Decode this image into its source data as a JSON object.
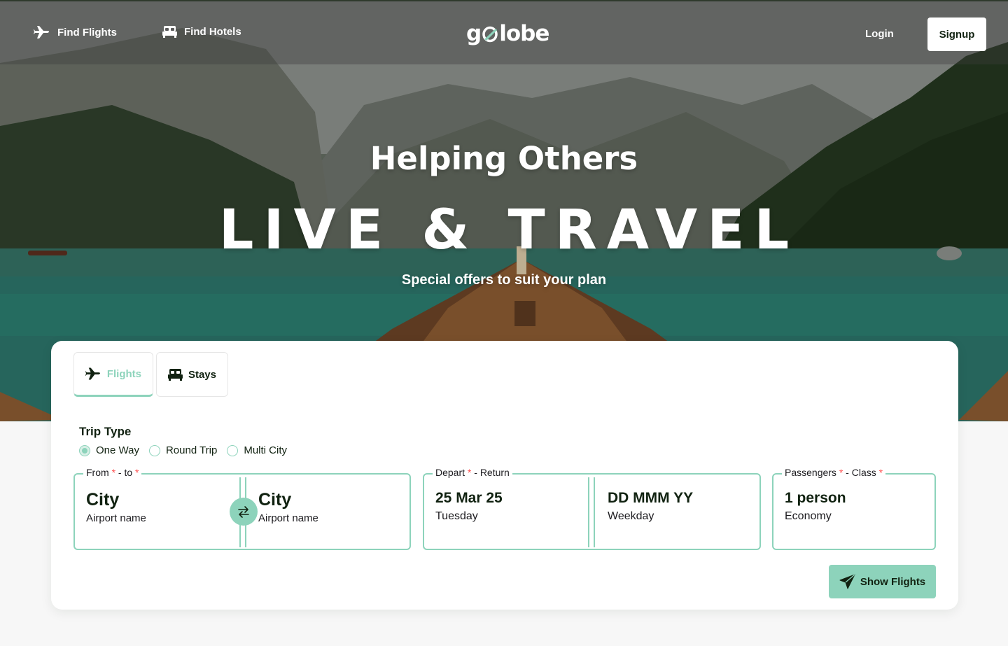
{
  "nav": {
    "find_flights": "Find Flights",
    "find_hotels": "Find Hotels",
    "logo": {
      "left": "g",
      "right": "lobe"
    },
    "login": "Login",
    "signup": "Signup"
  },
  "hero": {
    "title": "Helping Others",
    "headline": "LIVE & TRAVEL",
    "subtitle": "Special offers to suit your plan"
  },
  "search": {
    "tabs": [
      {
        "label": "Flights",
        "icon": "airplane-icon",
        "active": true
      },
      {
        "label": "Stays",
        "icon": "bed-icon",
        "active": false
      }
    ],
    "trip_type": {
      "title": "Trip Type",
      "options": [
        {
          "label": "One Way",
          "checked": true
        },
        {
          "label": "Round Trip",
          "checked": false
        },
        {
          "label": "Multi City",
          "checked": false
        }
      ]
    },
    "route": {
      "legend_from": "From",
      "legend_sep": " - to",
      "required_mark": "*",
      "from": {
        "city": "City",
        "airport": "Airport name"
      },
      "to": {
        "city": "City",
        "airport": "Airport name"
      }
    },
    "dates": {
      "legend_depart": "Depart",
      "legend_sep": " - Return",
      "depart": {
        "date": "25 Mar 25",
        "weekday": "Tuesday"
      },
      "return": {
        "date": "DD MMM YY",
        "weekday": "Weekday"
      }
    },
    "passengers": {
      "legend_pass": "Passengers",
      "legend_sep": " - Class",
      "count": "1 person",
      "class": "Economy"
    },
    "submit": "Show Flights"
  },
  "colors": {
    "accent": "#8dd3bb",
    "text": "#112211",
    "required": "#ff4d4d",
    "page_bg": "#f7f7f7"
  }
}
